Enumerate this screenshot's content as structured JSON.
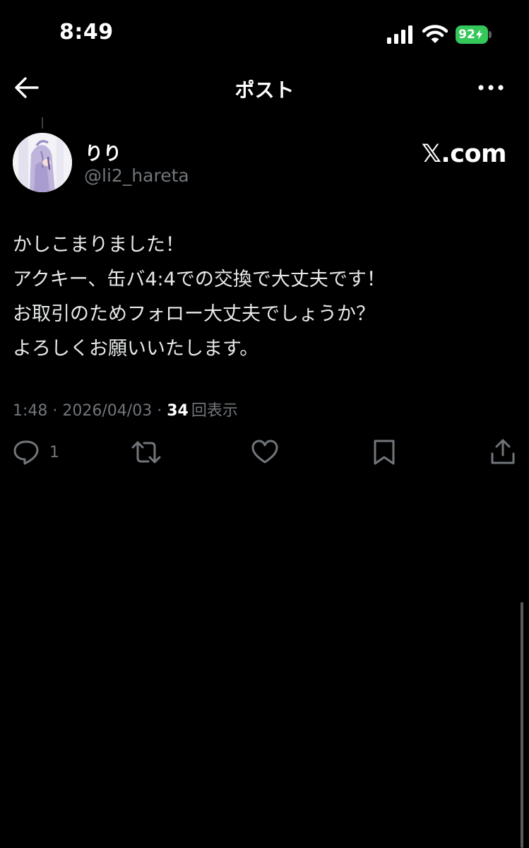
{
  "status_bar": {
    "time": "8:49",
    "battery": "92",
    "icons": [
      "cellular-signal-icon",
      "wifi-icon",
      "battery-icon"
    ]
  },
  "nav": {
    "title": "ポスト",
    "back_icon": "arrow-left-icon",
    "more_icon": "more-dots-icon"
  },
  "post": {
    "author": {
      "display_name": "りり",
      "handle": "@li2_hareta"
    },
    "source": "𝕏.com",
    "text_lines": [
      "かしこまりました！",
      "アクキー、缶バ4:4での交換で大丈夫です！",
      "お取引のためフォロー大丈夫でしょうか？",
      "よろしくお願いいたします。"
    ],
    "meta": {
      "time": "1:48",
      "separator": " · ",
      "date": "2026/04/03",
      "views": "34",
      "views_label": "回表示"
    },
    "actions": {
      "reply_count": "1",
      "icons": [
        "reply-icon",
        "repost-icon",
        "like-icon",
        "bookmark-icon",
        "share-icon"
      ]
    }
  },
  "colors": {
    "background": "#000000",
    "text": "#e7e9ea",
    "secondary": "#71767b",
    "battery": "#34c759"
  }
}
